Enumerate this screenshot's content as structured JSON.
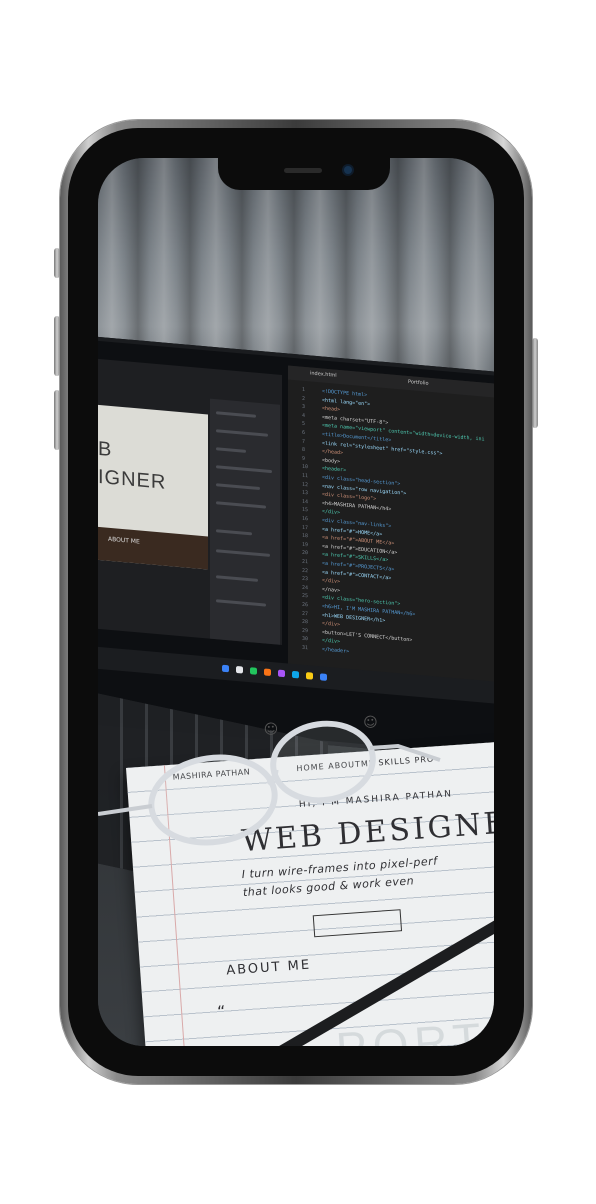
{
  "photo": {
    "design_hero": "B\nIGNER",
    "design_about": "ABOUT ME",
    "code_lines": [
      "<!DOCTYPE html>",
      "<html lang=\"en\">",
      "<head>",
      "  <meta charset=\"UTF-8\">",
      "  <meta name=\"viewport\" content=\"width=device-width, ini",
      "  <title>Document</title>",
      "  <link rel=\"stylesheet\" href=\"style.css\">",
      "</head>",
      "<body>",
      "  <header>",
      "    <div class=\"head-section\">",
      "      <nav class=\"row navigation\">",
      "        <div class=\"logo\">",
      "          <h4>MASHIRA PATHAN</h4>",
      "        </div>",
      "        <div class=\"nav-links\">",
      "          <a href=\"#\">HOME</a>",
      "          <a href=\"#\">ABOUT ME</a>",
      "          <a href=\"#\">EDUCATION</a>",
      "          <a href=\"#\">SKILLS</a>",
      "          <a href=\"#\">PROJECTS</a>",
      "          <a href=\"#\">CONTACT</a>",
      "        </div>",
      "      </nav>",
      "      <div class=\"hero-section\">",
      "        <h6>HI, I'M MASHIRA PATHAN</h6>",
      "        <h1>WEB DESIGNER</h1>",
      "      </div>",
      "      <button>LET'S CONNECT</button>",
      "    </div>",
      "  </header>"
    ],
    "editor_search": "Portfolio",
    "editor_tab": "index.html",
    "sketch": {
      "logo": "MASHIRA PATHAN",
      "nav": "HOME  ABOUTME  SKILLS  PRO",
      "greeting": "HI, I'M MASHIRA PATHAN",
      "title": "WEB DESIGNER",
      "tagline_1": "I turn wire-frames into pixel-perf",
      "tagline_2": "that looks good & work even",
      "section": "ABOUT ME",
      "quote": "“",
      "watermark": "PORTFOLI"
    }
  }
}
